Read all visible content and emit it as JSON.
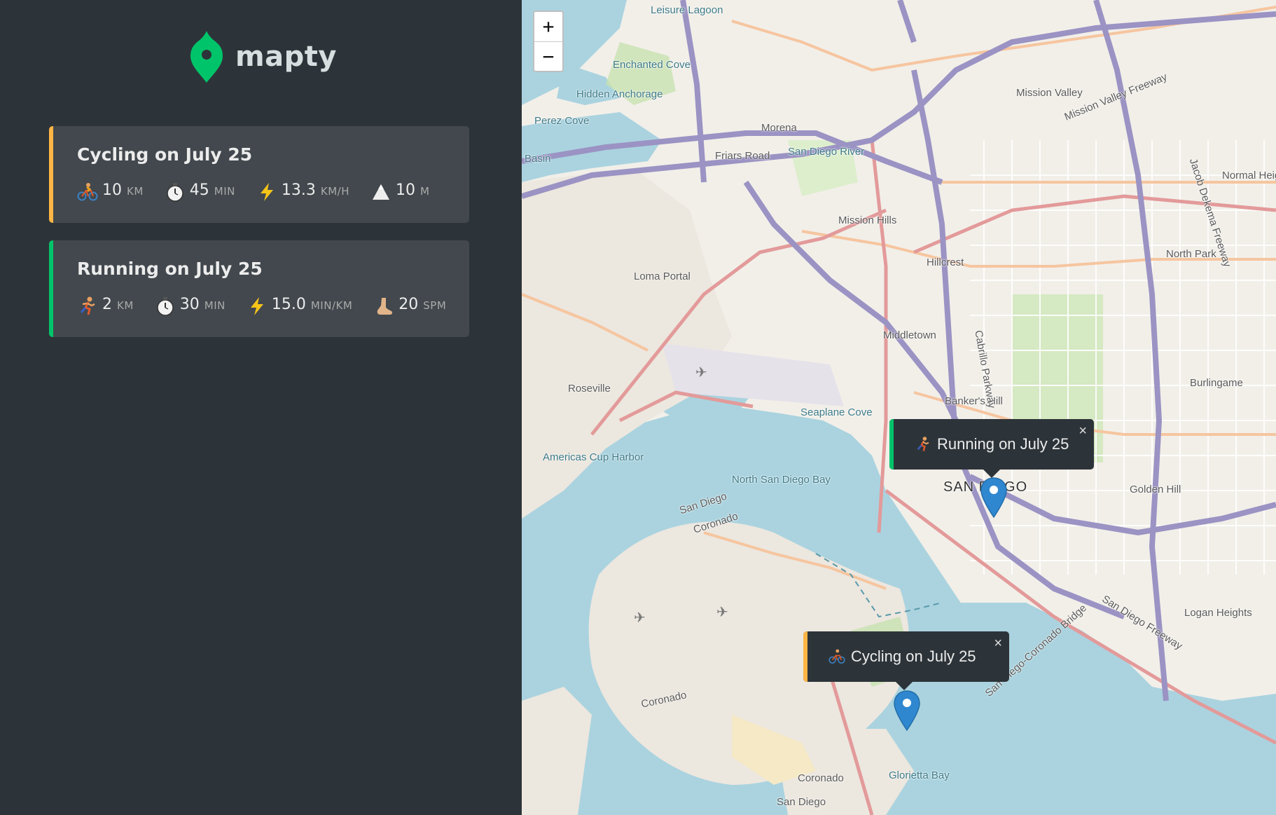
{
  "app": {
    "name": "mapty"
  },
  "colors": {
    "cycling": "#ffb545",
    "running": "#00c46a",
    "sidebar": "#2d3439",
    "card": "#42484d"
  },
  "workouts": [
    {
      "title": "Cycling on July 25",
      "type": "cycling",
      "details": [
        {
          "icon": "bicycle-icon",
          "value": "10",
          "unit": "KM"
        },
        {
          "icon": "stopwatch-icon",
          "value": "45",
          "unit": "MIN"
        },
        {
          "icon": "lightning-icon",
          "value": "13.3",
          "unit": "KM/H"
        },
        {
          "icon": "mountain-icon",
          "value": "10",
          "unit": "M"
        }
      ]
    },
    {
      "title": "Running on July 25",
      "type": "running",
      "details": [
        {
          "icon": "runner-icon",
          "value": "2",
          "unit": "KM"
        },
        {
          "icon": "stopwatch-icon",
          "value": "30",
          "unit": "MIN"
        },
        {
          "icon": "lightning-icon",
          "value": "15.0",
          "unit": "MIN/KM"
        },
        {
          "icon": "foot-icon",
          "value": "20",
          "unit": "SPM"
        }
      ]
    }
  ],
  "map": {
    "zoom_in": "+",
    "zoom_out": "−",
    "popups": [
      {
        "text": "Running on July 25",
        "close": "×"
      },
      {
        "text": "Cycling on July 25",
        "close": "×"
      }
    ],
    "labels": [
      "Leisure Lagoon",
      "Enchanted Cove",
      "Hidden Anchorage",
      "Perez Cove",
      "Basin",
      "Morena",
      "Friars Road",
      "San Diego River",
      "Mission Valley",
      "Mission Valley Freeway",
      "Mission Hills",
      "Hillcrest",
      "North Park",
      "Normal Heights",
      "Loma Portal",
      "Middletown",
      "Roseville",
      "Banker's Hill",
      "Burlingame",
      "Seaplane Cove",
      "Americas Cup Harbor",
      "North San Diego Bay",
      "SAN DIEGO",
      "Golden Hill",
      "San Diego",
      "Coronado",
      "Logan Heights",
      "San Diego Freeway",
      "San Diego-Coronado Bridge",
      "Coronado",
      "Glorietta Bay",
      "Coronado",
      "San Diego",
      "Cabrillo Parkway",
      "Jacob Dekema Freeway"
    ]
  }
}
